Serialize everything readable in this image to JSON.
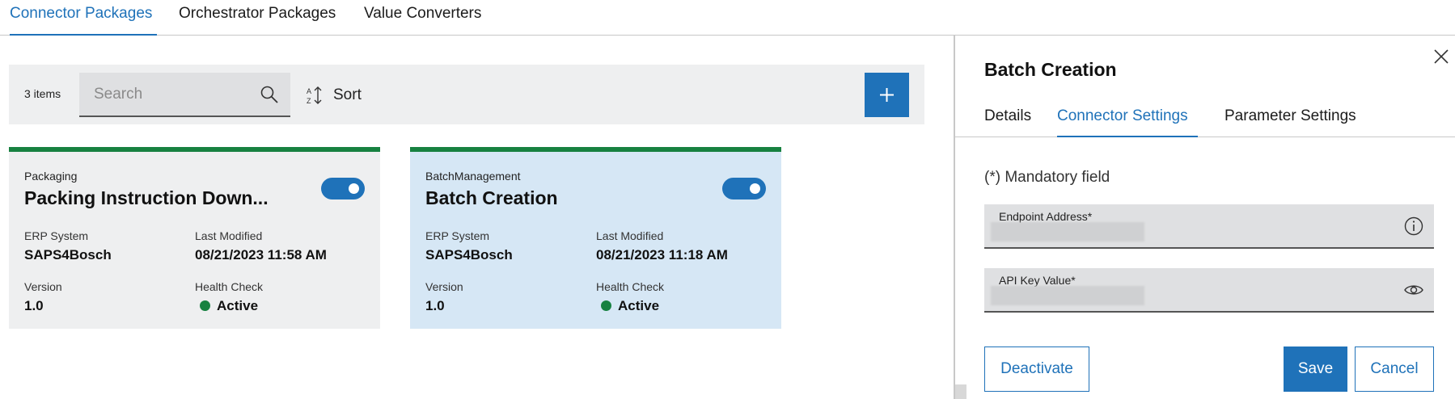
{
  "colors": {
    "accent": "#1f72b9",
    "status_active": "#178140",
    "card_selected_bg": "#d6e7f5",
    "card_bg": "#eeeff0"
  },
  "tabs": [
    {
      "label": "Connector Packages",
      "active": true
    },
    {
      "label": "Orchestrator Packages",
      "active": false
    },
    {
      "label": "Value Converters",
      "active": false
    }
  ],
  "toolbar": {
    "items_count": "3 items",
    "search_placeholder": "Search",
    "search_icon": "search-icon",
    "sort_label": "Sort",
    "sort_icon": "sort-az-icon",
    "add_icon": "plus-icon"
  },
  "cards": [
    {
      "category": "Packaging",
      "title": "Packing Instruction Down...",
      "enabled": true,
      "selected": false,
      "erp_label": "ERP System",
      "erp_value": "SAPS4Bosch",
      "modified_label": "Last Modified",
      "modified_value": "08/21/2023 11:58 AM",
      "version_label": "Version",
      "version_value": "1.0",
      "health_label": "Health Check",
      "health_value": "Active"
    },
    {
      "category": "BatchManagement",
      "title": "Batch Creation",
      "enabled": true,
      "selected": true,
      "erp_label": "ERP System",
      "erp_value": "SAPS4Bosch",
      "modified_label": "Last Modified",
      "modified_value": "08/21/2023 11:18 AM",
      "version_label": "Version",
      "version_value": "1.0",
      "health_label": "Health Check",
      "health_value": "Active"
    }
  ],
  "panel": {
    "title": "Batch Creation",
    "close_icon": "close-icon",
    "tabs": [
      {
        "label": "Details",
        "active": false
      },
      {
        "label": "Connector Settings",
        "active": true
      },
      {
        "label": "Parameter Settings",
        "active": false
      }
    ],
    "mandatory_note": "(*) Mandatory field",
    "fields": [
      {
        "label": "Endpoint Address*",
        "icon": "info-icon"
      },
      {
        "label": "API Key Value*",
        "icon": "eye-icon"
      }
    ],
    "buttons": {
      "deactivate": "Deactivate",
      "save": "Save",
      "cancel": "Cancel"
    }
  }
}
